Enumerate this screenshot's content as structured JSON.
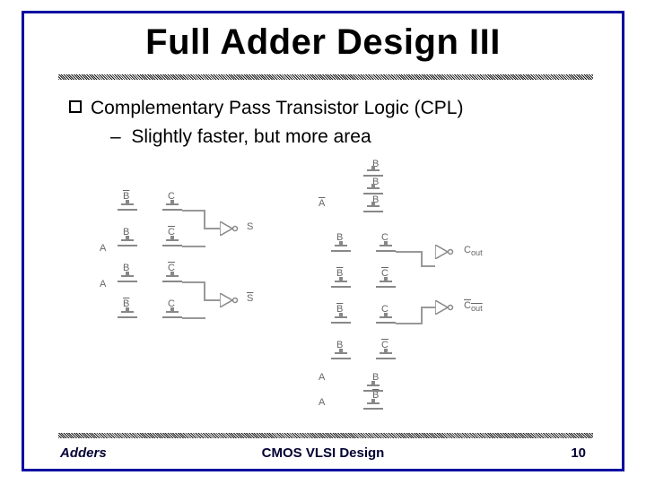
{
  "title": "Full Adder Design III",
  "bullets": {
    "b1": "Complementary Pass Transistor Logic (CPL)",
    "b2": "Slightly faster, but more area"
  },
  "diagram": {
    "left_inputs_col1": [
      "B",
      "B",
      "B",
      "B"
    ],
    "left_inputs_col2": [
      "C",
      "C",
      "C",
      "C"
    ],
    "left_side_labels": [
      "A",
      "A"
    ],
    "left_outputs": [
      "S",
      "S"
    ],
    "right_top_labels": [
      "B",
      "B",
      "B"
    ],
    "right_side_label": "A",
    "right_inputs_col1": [
      "B",
      "B",
      "B",
      "B"
    ],
    "right_inputs_col2": [
      "C",
      "C",
      "C",
      "C"
    ],
    "right_outputs": [
      "Cout",
      "Cout"
    ],
    "right_bottom": [
      "A",
      "A"
    ]
  },
  "footer": {
    "left": "Adders",
    "center": "CMOS VLSI Design",
    "right": "10"
  }
}
